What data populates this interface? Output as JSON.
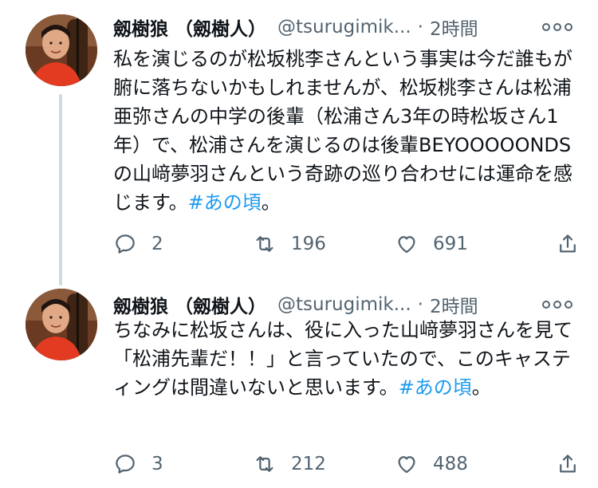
{
  "tweets": [
    {
      "author": {
        "display_name": "劔樹狼 （劔樹人）",
        "handle": "@tsurugimik...",
        "separator": "·",
        "time": "2時間"
      },
      "text_parts": [
        "私を演じるのが松坂桃李さんという事実は今だ誰もが腑に落ちないかもしれませんが、松坂桃李さんは松浦亜弥さんの中学の後輩（松浦さん3年の時松坂さん1年）で、松浦さんを演じるのは後輩BEYOOOOONDSの山﨑夢羽さんという奇跡の巡り合わせには運命を感じます。",
        "#あの頃",
        "。"
      ],
      "stats": {
        "replies": "2",
        "retweets": "196",
        "likes": "691"
      },
      "avatar_icon": "user-photo"
    },
    {
      "author": {
        "display_name": "劔樹狼 （劔樹人）",
        "handle": "@tsurugimik...",
        "separator": "·",
        "time": "2時間"
      },
      "text_parts": [
        "ちなみに松坂さんは、役に入った山﨑夢羽さんを見て「松浦先輩だ！！」と言っていたので、このキャスティングは間違いないと思います。",
        "#あの頃",
        "。"
      ],
      "stats": {
        "replies": "3",
        "retweets": "212",
        "likes": "488"
      },
      "avatar_icon": "user-photo"
    }
  ],
  "icons": {
    "reply": "reply-icon",
    "retweet": "retweet-icon",
    "like": "heart-icon",
    "share": "share-icon",
    "more": "more-icon"
  },
  "colors": {
    "hashtag": "#1d9bf0",
    "muted": "#536471",
    "thread_line": "#cfd9de"
  }
}
